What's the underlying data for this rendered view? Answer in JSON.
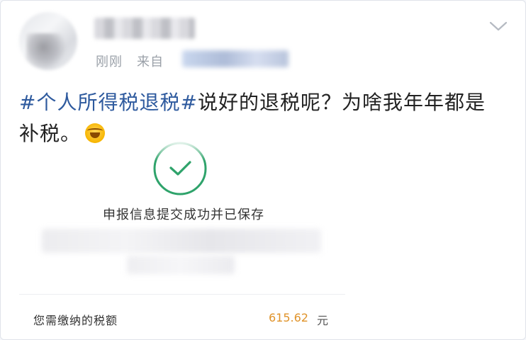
{
  "post": {
    "time": "刚刚",
    "source_prefix": "来自",
    "hashtag": "#个人所得税退税#",
    "text_line1": "说好的退税呢？为啥我年年都是",
    "text_line2": "补税。",
    "emoji": "laugh-cry-emoji"
  },
  "embedded": {
    "success_message": "申报信息提交成功并已保存",
    "tax_label": "您需缴纳的税额",
    "tax_amount": "615.62",
    "tax_unit": "元"
  },
  "colors": {
    "hashtag": "#2e5a9e",
    "success_green": "#2fa36b",
    "amount_orange": "#e0932a"
  }
}
